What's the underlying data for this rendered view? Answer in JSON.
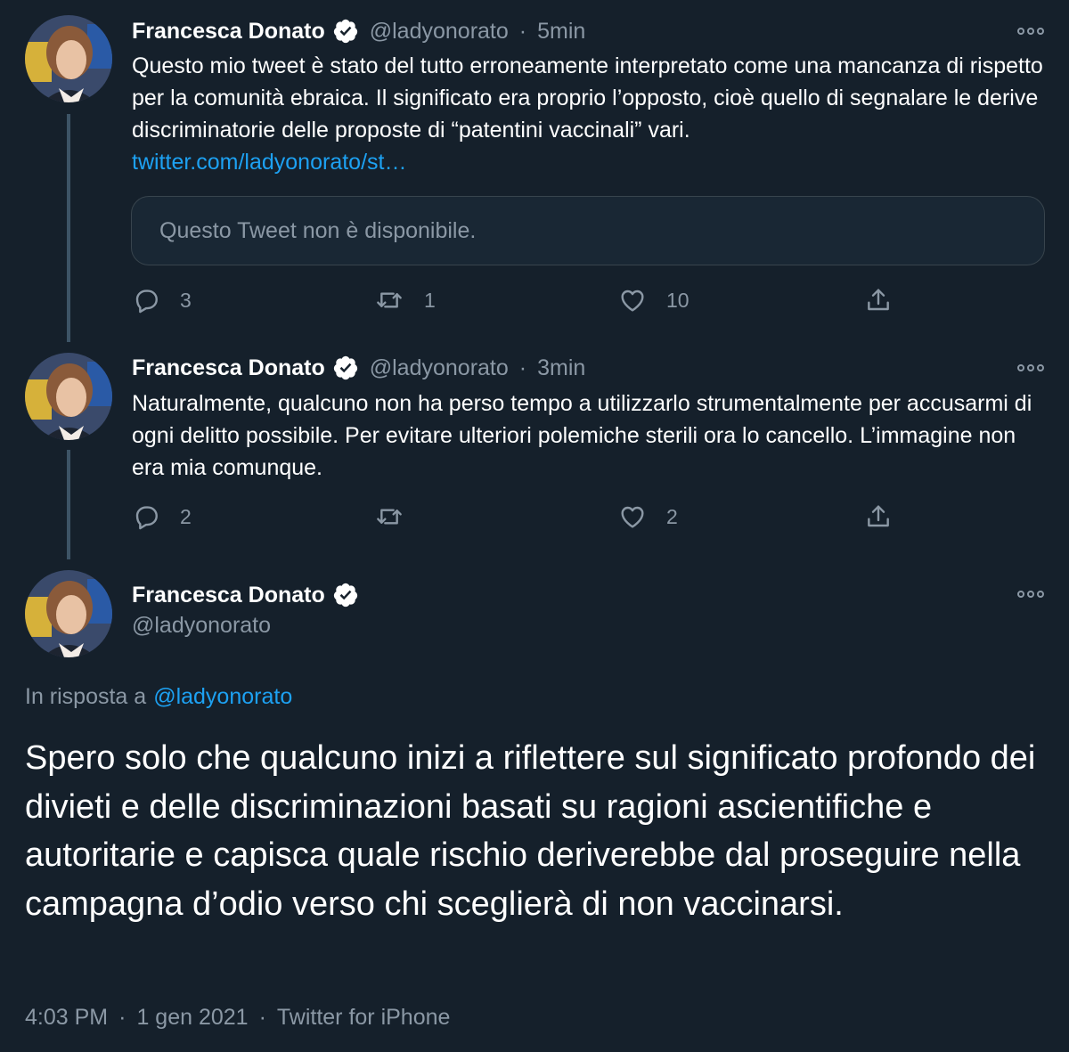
{
  "thread": [
    {
      "author": {
        "name": "Francesca Donato",
        "handle": "@ladyonorato"
      },
      "time": "5min",
      "text": "Questo mio tweet è stato del tutto erroneamente interpretato come una mancanza di rispetto per la comunità ebraica. Il significato era proprio l’opposto, cioè quello di segnalare le derive discriminatorie delle proposte di “patentini vaccinali” vari.",
      "link": "twitter.com/ladyonorato/st…",
      "quoted": "Questo Tweet non è disponibile.",
      "actions": {
        "reply": "3",
        "retweet": "1",
        "like": "10"
      }
    },
    {
      "author": {
        "name": "Francesca Donato",
        "handle": "@ladyonorato"
      },
      "time": "3min",
      "text": "Naturalmente, qualcuno non ha perso tempo a utilizzarlo strumentalmente per accusarmi di ogni delitto possibile. Per evitare ulteriori polemiche sterili ora lo cancello. L’immagine non era mia comunque.",
      "actions": {
        "reply": "2",
        "retweet": "",
        "like": "2"
      }
    }
  ],
  "main_tweet": {
    "author": {
      "name": "Francesca Donato",
      "handle": "@ladyonorato"
    },
    "reply_prefix": "In risposta a",
    "reply_mention": "@ladyonorato",
    "text": "Spero solo che qualcuno inizi a riflettere sul significato profondo dei divieti e delle discriminazioni basati su ragioni ascientifiche e autoritarie e capisca quale rischio deriverebbe dal proseguire nella campagna d’odio verso chi sceglierà di non vaccinarsi.",
    "time": "4:03 PM",
    "date": "1 gen 2021",
    "source": "Twitter for iPhone",
    "separator": "·"
  },
  "separator": "·",
  "colors": {
    "background": "#15202b",
    "text": "#ffffff",
    "secondary": "#8b98a5",
    "link": "#1da1f2",
    "verified": "#ffffff"
  },
  "icons": [
    "verified-badge-icon",
    "more-options-icon",
    "reply-icon",
    "retweet-icon",
    "like-icon",
    "share-icon"
  ]
}
